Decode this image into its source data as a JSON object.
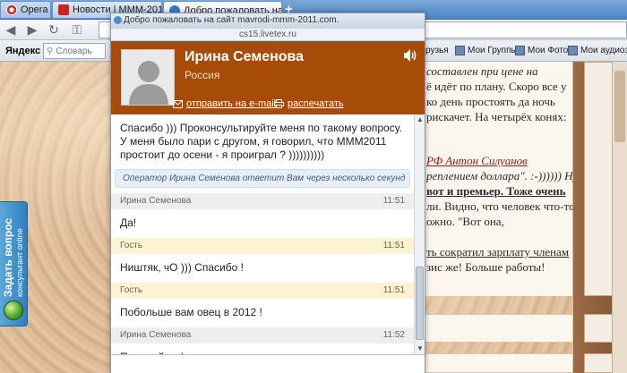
{
  "browser": {
    "opera_tab": "Opera",
    "tabs": [
      {
        "label": "Новости | МММ-2012 Се..."
      },
      {
        "label": "Добро пожаловать на с..."
      }
    ],
    "add_tab": "+",
    "search_engine": "Яндекс",
    "search_placeholder": "Словарь",
    "bookmarks": [
      {
        "label": "рузья"
      },
      {
        "label": "Мои Группы"
      },
      {
        "label": "Мои Фото"
      },
      {
        "label": "Мои аудиоза"
      }
    ]
  },
  "article": {
    "lines": [
      "составлен при цене на",
      "ё идёт по плану. Скоро все у",
      "ко день простоять да ночь",
      "рискачет. На четырёх конях:"
    ],
    "lines2_link": "РФ Антон Силуанов",
    "lines2": [
      "реплением доллара\". :-)))))) Ну,",
      "вот и премьер. Тоже очень",
      "ли. Видно, что человек что-то",
      "ожно. \"Вот она,"
    ],
    "line3_link": "ть сократил зарплату членам",
    "line3": "зис же! Больше работы!"
  },
  "side_tab": {
    "title": "Задать вопрос",
    "subtitle": "консультант online"
  },
  "chat": {
    "window_title": "Добро пожаловать на сайт mavrodi-mmm-2011.com.",
    "url": "cs15.livetex.ru",
    "operator": {
      "name": "Ирина Семенова",
      "country": "Россия"
    },
    "email_link": "отправить на e-mail",
    "print_link": "распечатать",
    "first_message": "Спасибо ))) Проконсультируйте меня по такому вопросу. У меня было пари с другом, я говорил, что МММ2011 простоит до осени - я проиграл ? ))))))))))",
    "system_note": "Оператор Ирина Семенова ответит Вам через несколько секунд",
    "messages": [
      {
        "author": "Ирина Семенова",
        "time": "11:51",
        "text": "Да!",
        "role": "op"
      },
      {
        "author": "Гость",
        "time": "11:51",
        "text": "Ништяк, чО ))) Спасибо !",
        "role": "guest"
      },
      {
        "author": "Гость",
        "time": "11:51",
        "text": "Побольше вам овец в 2012 !",
        "role": "guest"
      },
      {
        "author": "Ирина Семенова",
        "time": "11:52",
        "text": "Пожалуйста!",
        "role": "op"
      }
    ]
  },
  "colors": {
    "header": "#a64b08",
    "tabbar": "#4e84c4",
    "side_tab": "#2f7fbf"
  }
}
